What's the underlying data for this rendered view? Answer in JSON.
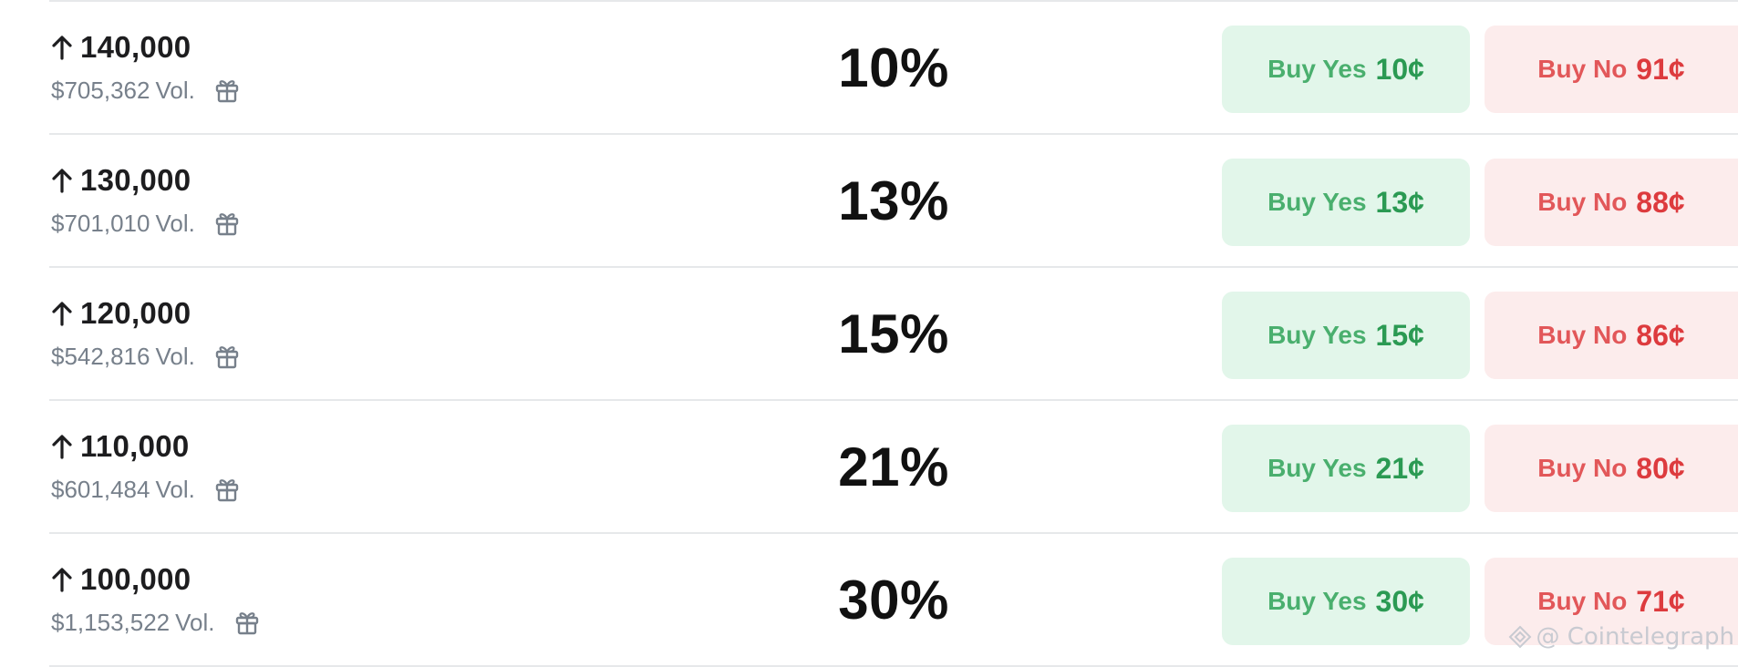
{
  "buttons": {
    "yes_label": "Buy Yes",
    "no_label": "Buy No"
  },
  "volume_suffix": "Vol.",
  "rows": [
    {
      "threshold": "140,000",
      "volume": "$705,362",
      "chance": "10%",
      "yes_price": "10¢",
      "no_price": "91¢"
    },
    {
      "threshold": "130,000",
      "volume": "$701,010",
      "chance": "13%",
      "yes_price": "13¢",
      "no_price": "88¢"
    },
    {
      "threshold": "120,000",
      "volume": "$542,816",
      "chance": "15%",
      "yes_price": "15¢",
      "no_price": "86¢"
    },
    {
      "threshold": "110,000",
      "volume": "$601,484",
      "chance": "21%",
      "yes_price": "21¢",
      "no_price": "80¢"
    },
    {
      "threshold": "100,000",
      "volume": "$1,153,522",
      "chance": "30%",
      "yes_price": "30¢",
      "no_price": "71¢"
    }
  ],
  "watermark": "@ Cointelegraph",
  "icons": {
    "row_direction": "arrow-up-icon",
    "rewards": "gift-icon",
    "watermark_logo": "cointelegraph-logo-icon"
  },
  "colors": {
    "yes_bg": "#e2f6ea",
    "yes_text": "#3aa861",
    "no_bg": "#fcecec",
    "no_text": "#e0474a",
    "muted_text": "#77808b",
    "divider": "#e6e8ea"
  }
}
